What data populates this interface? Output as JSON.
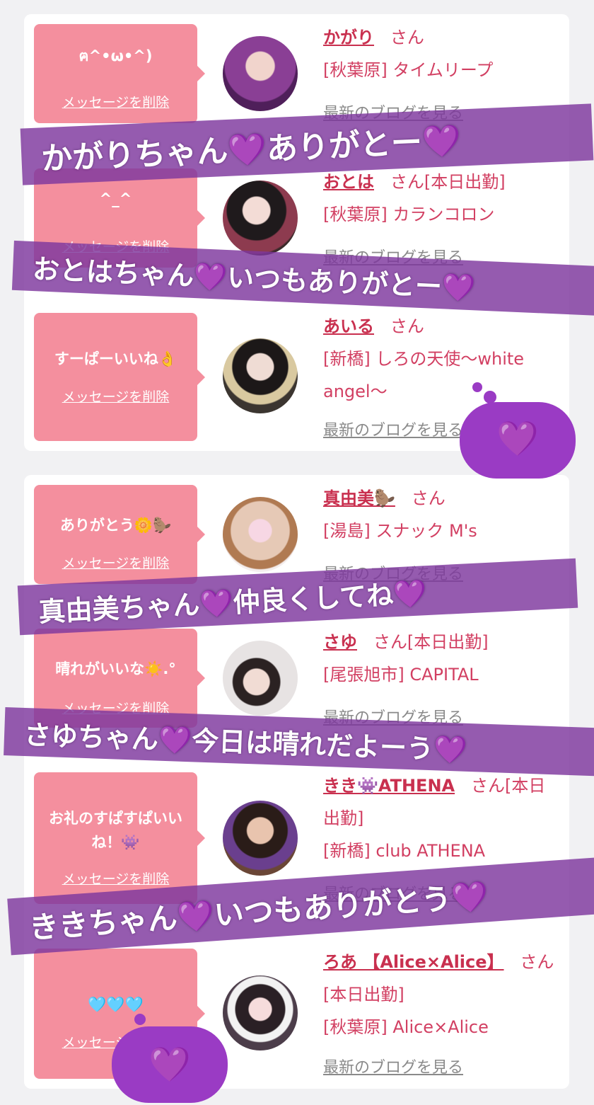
{
  "common": {
    "delete_label": "メッセージを削除",
    "blog_label": "最新のブログを見る",
    "san": "さん"
  },
  "items": [
    {
      "message": "ฅ^•ω•^)",
      "name": "かがり",
      "status": "",
      "store": "[秋葉原] タイムリープ",
      "avatar_color": "#7a3c8e"
    },
    {
      "message": "^_^",
      "name": "おとは",
      "status": "[本日出勤]",
      "store": "[秋葉原] カランコロン",
      "avatar_color": "#5a3a3a"
    },
    {
      "message": "すーぱーいいね👌",
      "name": "あいる",
      "status": "",
      "store": "[新橋] しろの天使〜white angel〜",
      "avatar_color": "#3b3530"
    },
    {
      "message": "ありがとう🌼🦫",
      "name": "真由美🦫",
      "status": "",
      "store": "[湯島] スナック M's",
      "avatar_color": "#e6c9b6"
    },
    {
      "message": "晴れがいいな☀️.°",
      "name": "さゆ",
      "status": "[本日出勤]",
      "store": "[尾張旭市] CAPITAL",
      "avatar_color": "#d8d2d0"
    },
    {
      "message": "お礼のすぱすぱいいね！👾",
      "name": "きき👾ATHENA",
      "status": "[本日出勤]",
      "store": "[新橋] club ATHENA",
      "avatar_color": "#6a4636"
    },
    {
      "message": "🩵🩵🩵",
      "name": "ろあ 【Alice×Alice】",
      "status": "[本日出勤]",
      "store": "[秋葉原] Alice×Alice",
      "avatar_color": "#4c3d4a"
    }
  ],
  "banners": [
    "かがりちゃん💜ありがとー💜",
    "おとはちゃん💜いつもありがとー💜",
    "真由美ちゃん💜仲良くしてね💜",
    "さゆちゃん💜今日は晴れだよーう💜",
    "ききちゃん💜いつもありがとう💜"
  ],
  "stickers": [
    "💜",
    "💜"
  ],
  "colors": {
    "bubble": "#f48f9e",
    "name": "#c9304f",
    "banner": "#7e379e",
    "background": "#f1f1f3"
  }
}
